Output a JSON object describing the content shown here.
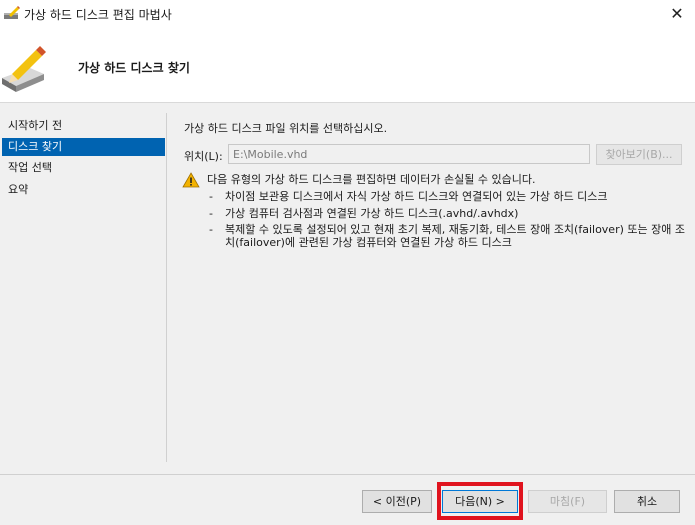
{
  "window": {
    "title": "가상 하드 디스크 편집 마법사",
    "close_glyph": "✕"
  },
  "header": {
    "title": "가상 하드 디스크 찾기"
  },
  "nav": {
    "items": [
      {
        "label": "시작하기 전"
      },
      {
        "label": "디스크 찾기",
        "selected": true
      },
      {
        "label": "작업 선택"
      },
      {
        "label": "요약"
      }
    ]
  },
  "content": {
    "instruction": "가상 하드 디스크 파일 위치를 선택하십시오.",
    "location_label": "위치(L):",
    "location_value": "E:\\Mobile.vhd",
    "browse_label": "찾아보기(B)...",
    "warning": "다음 유형의 가상 하드 디스크를 편집하면 데이터가 손실될 수 있습니다.",
    "bullets": [
      "차이점 보관용 디스크에서 자식 가상 하드 디스크와 연결되어 있는 가상 하드 디스크",
      "가상 컴퓨터 검사점과 연결된 가상 하드 디스크(.avhd/.avhdx)",
      "복제할 수 있도록 설정되어 있고 현재 초기 복제, 재동기화, 테스트 장애 조치(failover) 또는 장애 조치(failover)에 관련된 가상 컴퓨터와 연결된 가상 하드 디스크"
    ],
    "bullet_dash": "-"
  },
  "footer": {
    "prev_label": "< 이전(P)",
    "next_label": "다음(N) >",
    "finish_label": "마침(F)",
    "cancel_label": "취소"
  },
  "colors": {
    "selection": "#0063b1",
    "highlight_box": "#e0131e",
    "warning": "#f2b200"
  },
  "icons": {
    "app": "wizard-disk-icon",
    "header": "disk-pencil-icon",
    "warning": "warning-icon"
  }
}
